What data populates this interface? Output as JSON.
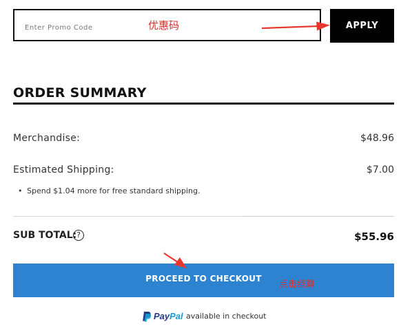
{
  "promo": {
    "placeholder": "Enter Promo Code",
    "annotation": "优惠码",
    "apply_label": "APPLY"
  },
  "summary": {
    "title": "ORDER SUMMARY",
    "merchandise_label": "Merchandise:",
    "merchandise_value": "$48.96",
    "shipping_label": "Estimated Shipping:",
    "shipping_value": "$7.00",
    "shipping_tip": "Spend $1.04 more for free standard shipping.",
    "subtotal_label": "SUB TOTAL:",
    "help_icon_glyph": "?",
    "subtotal_value": "$55.96"
  },
  "checkout": {
    "button_label": "PROCEED TO CHECKOUT",
    "annotation": "点击结算"
  },
  "paypal": {
    "brand_part1": "Pay",
    "brand_part2": "Pal",
    "text": "available in checkout",
    "icon": "paypal-logo-icon"
  },
  "colors": {
    "apply_bg": "#000000",
    "checkout_bg": "#2e83d1",
    "annotation_red": "#d9312a",
    "paypal_dark": "#253b80",
    "paypal_light": "#179bd7"
  }
}
